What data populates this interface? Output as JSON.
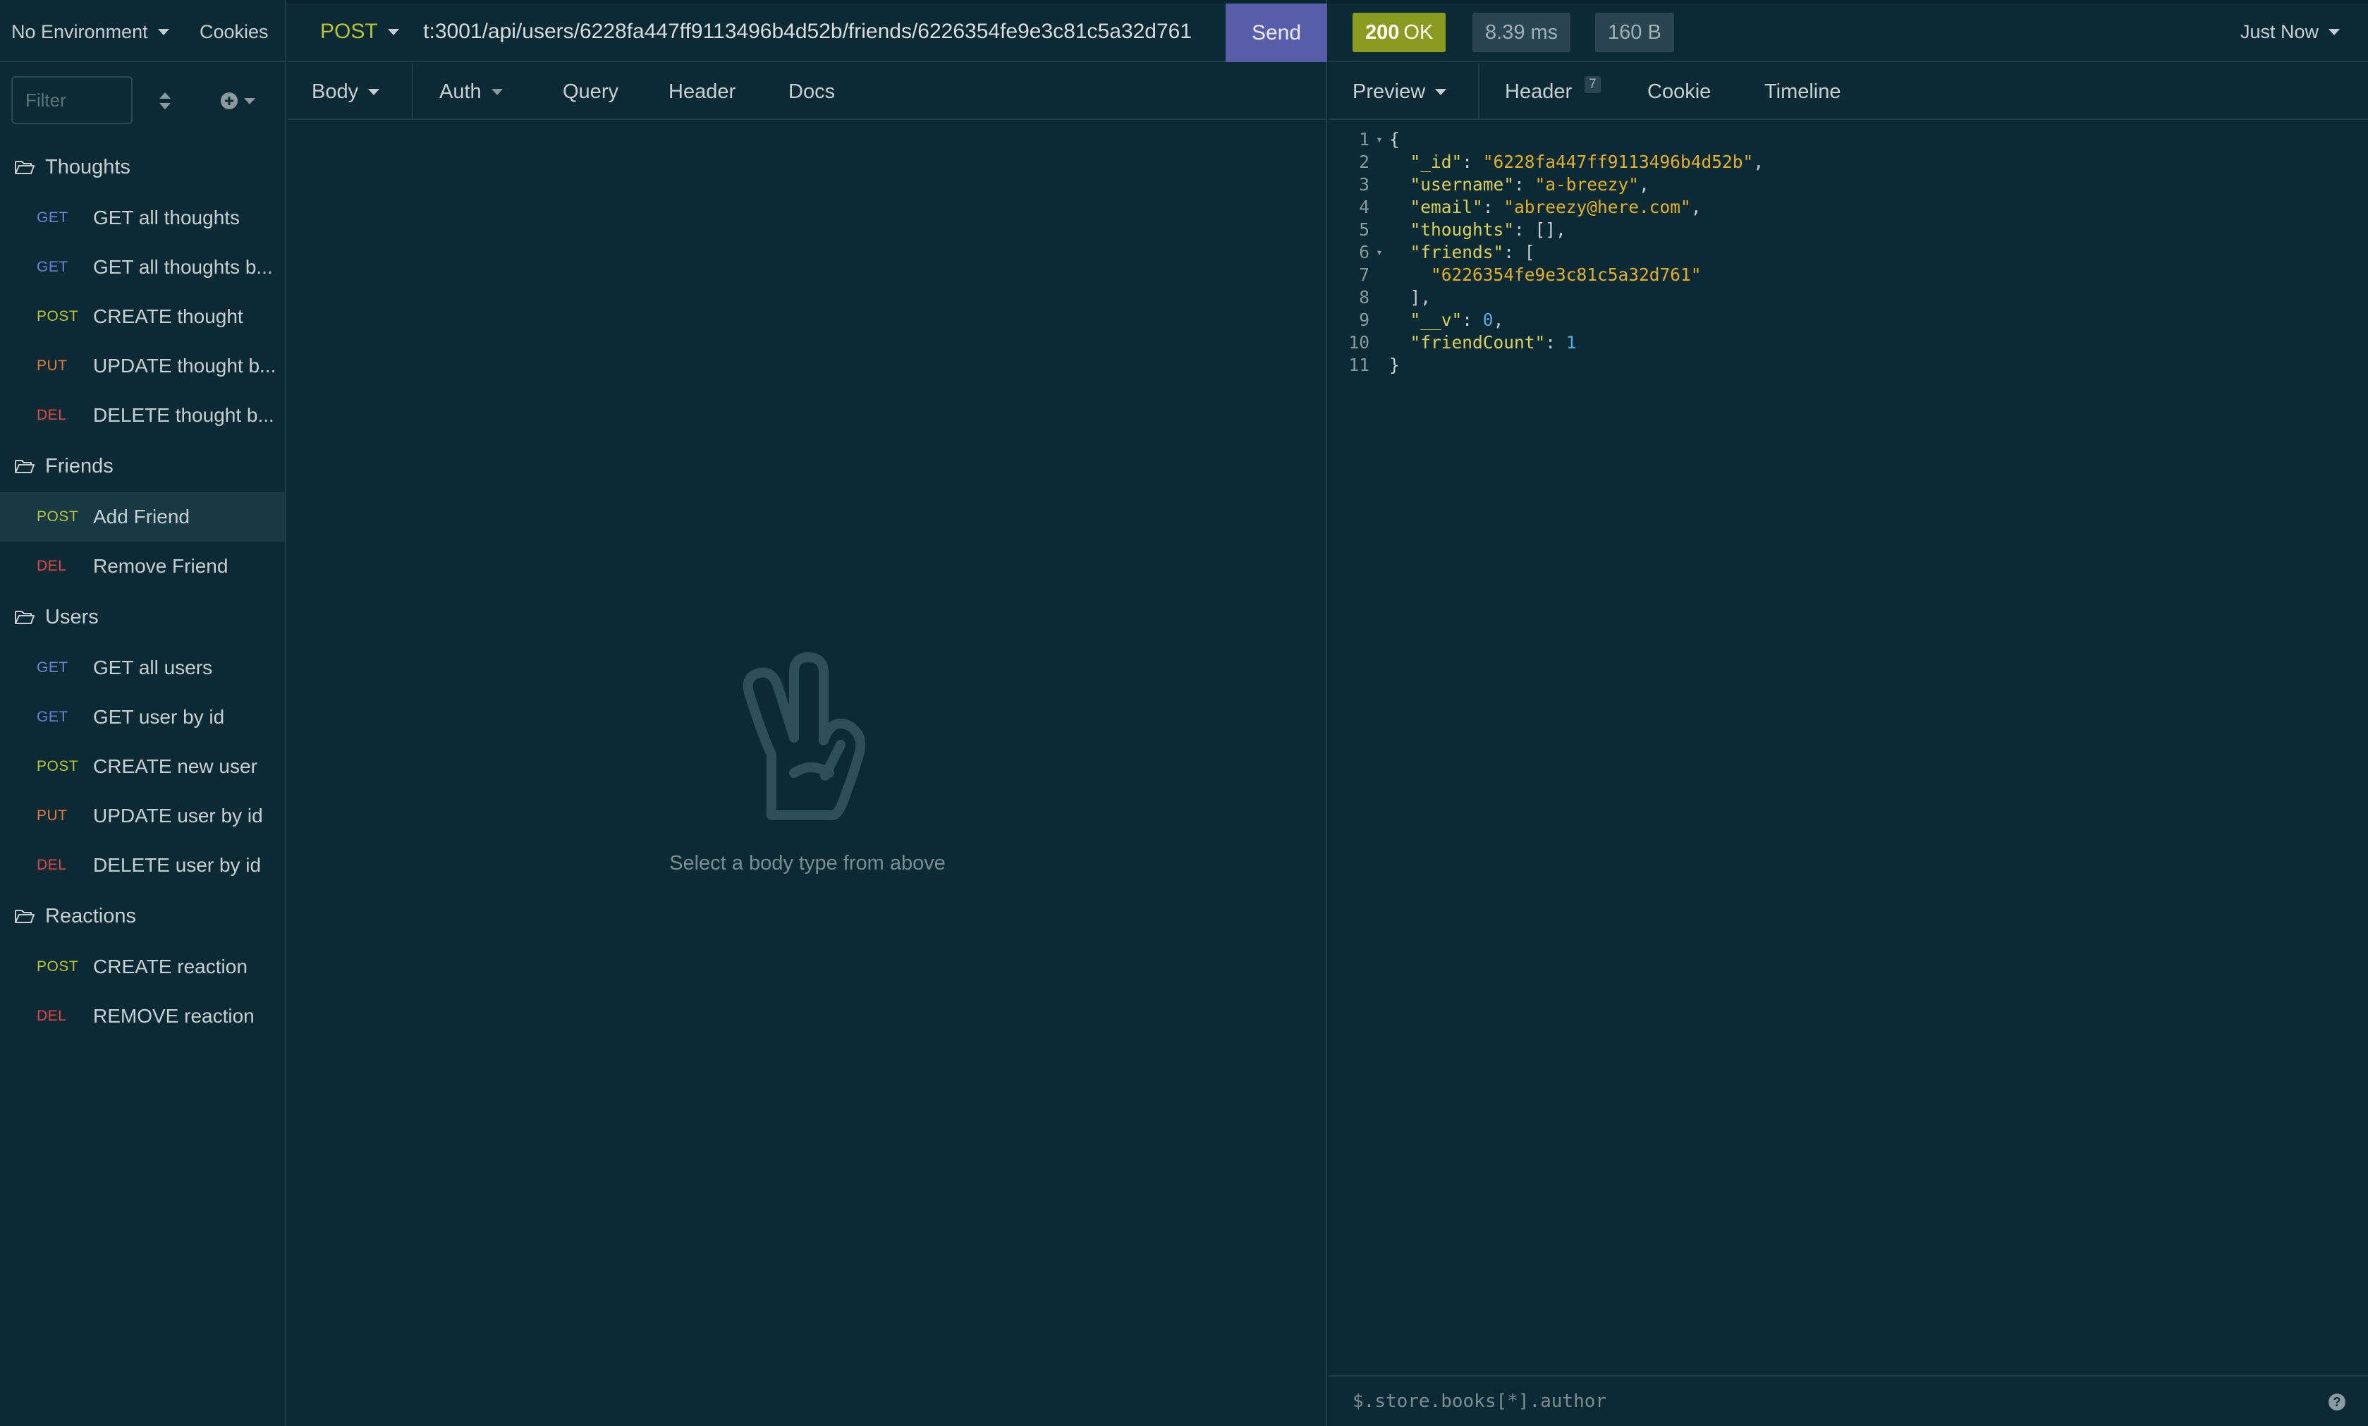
{
  "env": {
    "label": "No Environment",
    "cookies": "Cookies"
  },
  "filter": {
    "placeholder": "Filter"
  },
  "colors": {
    "get": "#6e82d6",
    "post": "#b8c43c",
    "put": "#e67a3c",
    "del": "#e04848"
  },
  "sidebar": {
    "folders": [
      {
        "name": "Thoughts",
        "requests": [
          {
            "method": "GET",
            "label": "GET all thoughts"
          },
          {
            "method": "GET",
            "label": "GET all thoughts b..."
          },
          {
            "method": "POST",
            "label": "CREATE thought"
          },
          {
            "method": "PUT",
            "label": "UPDATE thought b..."
          },
          {
            "method": "DEL",
            "label": "DELETE thought b..."
          }
        ]
      },
      {
        "name": "Friends",
        "requests": [
          {
            "method": "POST",
            "label": "Add Friend",
            "active": true
          },
          {
            "method": "DEL",
            "label": "Remove Friend"
          }
        ]
      },
      {
        "name": "Users",
        "requests": [
          {
            "method": "GET",
            "label": "GET all users"
          },
          {
            "method": "GET",
            "label": "GET user by id"
          },
          {
            "method": "POST",
            "label": "CREATE new user"
          },
          {
            "method": "PUT",
            "label": "UPDATE user by id"
          },
          {
            "method": "DEL",
            "label": "DELETE user by id"
          }
        ]
      },
      {
        "name": "Reactions",
        "requests": [
          {
            "method": "POST",
            "label": "CREATE reaction"
          },
          {
            "method": "DEL",
            "label": "REMOVE reaction"
          }
        ]
      }
    ]
  },
  "request": {
    "method": "POST",
    "url": "t:3001/api/users/6228fa447ff9113496b4d52b/friends/6226354fe9e3c81c5a32d761",
    "send": "Send",
    "tabs": {
      "body": "Body",
      "auth": "Auth",
      "query": "Query",
      "header": "Header",
      "docs": "Docs"
    },
    "empty_text": "Select a body type from above"
  },
  "response": {
    "status_code": "200",
    "status_text": "OK",
    "time": "8.39 ms",
    "size": "160 B",
    "timestamp": "Just Now",
    "tabs": {
      "preview": "Preview",
      "header": "Header",
      "header_count": "7",
      "cookie": "Cookie",
      "timeline": "Timeline"
    },
    "body_lines": [
      "{",
      "  \"_id\": \"6228fa447ff9113496b4d52b\",",
      "  \"username\": \"a-breezy\",",
      "  \"email\": \"abreezy@here.com\",",
      "  \"thoughts\": [],",
      "  \"friends\": [",
      "    \"6226354fe9e3c81c5a32d761\"",
      "  ],",
      "  \"__v\": 0,",
      "  \"friendCount\": 1",
      "}"
    ],
    "filter_placeholder": "$.store.books[*].author"
  }
}
